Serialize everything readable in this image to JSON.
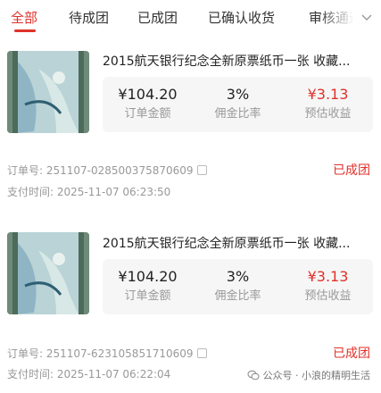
{
  "tabs": [
    {
      "label": "全部"
    },
    {
      "label": "待成团"
    },
    {
      "label": "已成团"
    },
    {
      "label": "已确认收货"
    },
    {
      "label": "审核通过"
    }
  ],
  "active_tab": "全部",
  "orders": [
    {
      "title": "2015航天银行纪念全新原票纸币一张 收藏...",
      "amount": "¥104.20",
      "amount_label": "订单金额",
      "rate": "3%",
      "rate_label": "佣金比率",
      "income": "¥3.13",
      "income_label": "预估收益",
      "order_no": "订单号: 251107-028500375870609",
      "pay_time": "支付时间: 2025-11-07 06:23:50",
      "status": "已成团"
    },
    {
      "title": "2015航天银行纪念全新原票纸币一张 收藏...",
      "amount": "¥104.20",
      "amount_label": "订单金额",
      "rate": "3%",
      "rate_label": "佣金比率",
      "income": "¥3.13",
      "income_label": "预估收益",
      "order_no": "订单号: 251107-623105851710609",
      "pay_time": "支付时间: 2025-11-07 06:22:04",
      "status": "已成团"
    }
  ],
  "watermark": "公众号 · 小浪的精明生活",
  "colors": {
    "accent": "#e0312a",
    "muted": "#999999",
    "card_bg": "#f6f6f6"
  }
}
